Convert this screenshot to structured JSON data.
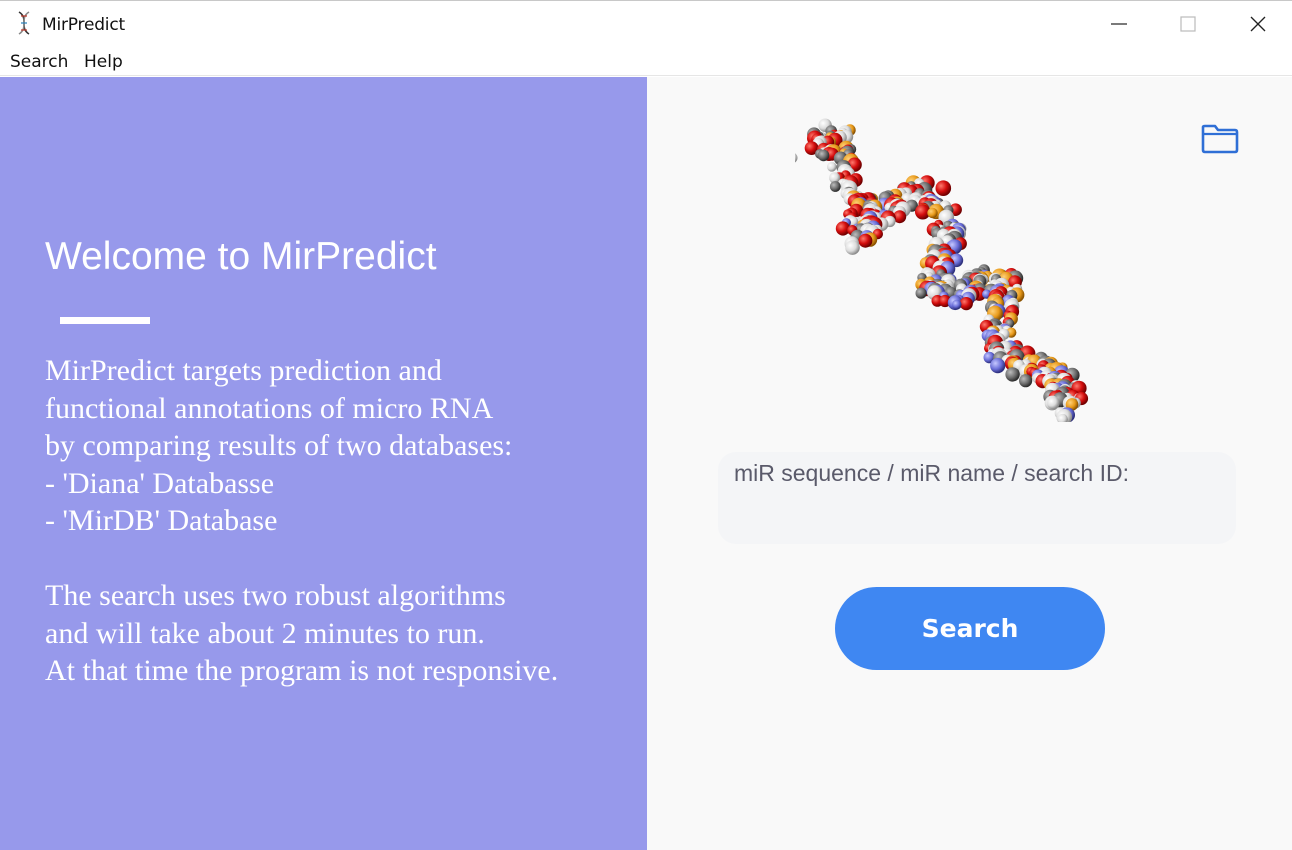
{
  "window": {
    "title": "MirPredict",
    "icon": "dna-icon",
    "controls": [
      "minimize-icon",
      "maximize-icon",
      "close-icon"
    ]
  },
  "menu": {
    "search_label": "Search",
    "help_label": "Help"
  },
  "left": {
    "heading": "Welcome to MirPredict",
    "description": "MirPredict targets prediction and\nfunctional annotations of micro RNA\nby comparing results of two databases:\n- 'Diana' Databasse\n- 'MirDB' Database\n\nThe search uses two robust algorithms\nand will take about 2 minutes to run.\nAt that time the program is not responsive.",
    "background_color": "#9799eb"
  },
  "right": {
    "image": "rna-molecule-illustration",
    "folder_icon": "folder-icon",
    "search_placeholder": "miR sequence / miR name / search ID:",
    "search_value": "",
    "search_button_label": "Search",
    "button_color": "#3f87f2"
  }
}
